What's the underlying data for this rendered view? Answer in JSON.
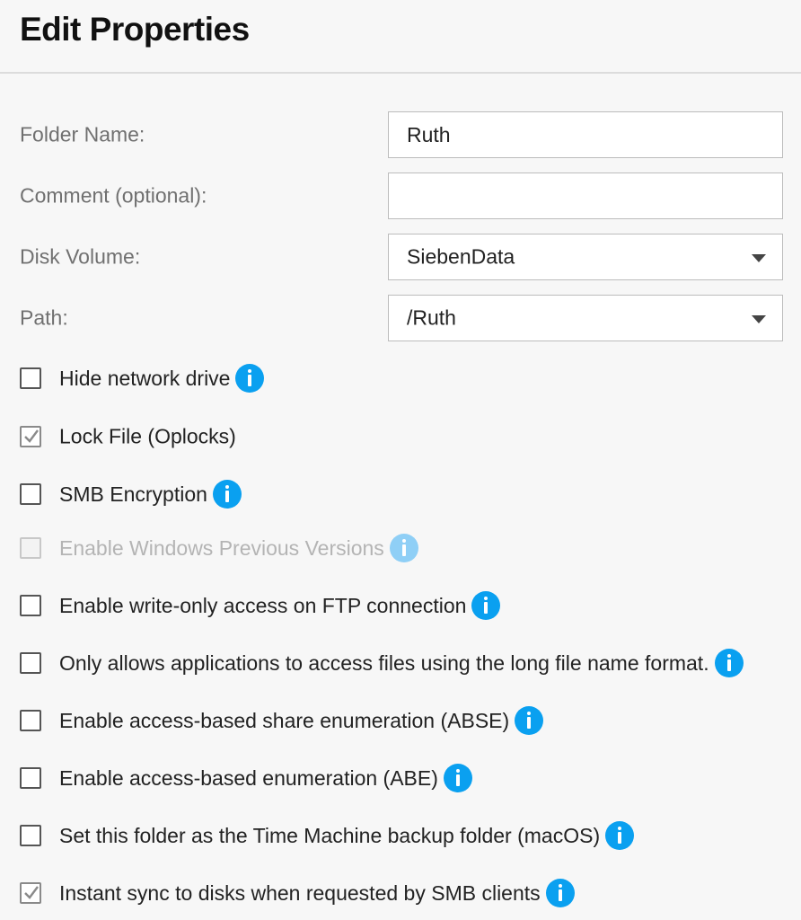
{
  "header": {
    "title": "Edit Properties"
  },
  "form": {
    "folder_name": {
      "label": "Folder Name:",
      "value": "Ruth"
    },
    "comment": {
      "label": "Comment (optional):",
      "value": "",
      "placeholder": ""
    },
    "disk_volume": {
      "label": "Disk Volume:",
      "value": "SiebenData"
    },
    "path": {
      "label": "Path:",
      "value": "/Ruth"
    }
  },
  "options": [
    {
      "label": "Hide network drive",
      "checked": false,
      "disabled": false,
      "info": true
    },
    {
      "label": "Lock File (Oplocks)",
      "checked": true,
      "disabled": false,
      "info": false
    },
    {
      "label": "SMB Encryption",
      "checked": false,
      "disabled": false,
      "info": true
    },
    {
      "label": "Enable Windows Previous Versions",
      "checked": false,
      "disabled": true,
      "info": true
    },
    {
      "label": "Enable write-only access on FTP connection",
      "checked": false,
      "disabled": false,
      "info": true
    },
    {
      "label": "Only allows applications to access files using the long file name format.",
      "checked": false,
      "disabled": false,
      "info": true
    },
    {
      "label": "Enable access-based share enumeration (ABSE)",
      "checked": false,
      "disabled": false,
      "info": true
    },
    {
      "label": "Enable access-based enumeration (ABE)",
      "checked": false,
      "disabled": false,
      "info": true
    },
    {
      "label": "Set this folder as the Time Machine backup folder (macOS)",
      "checked": false,
      "disabled": false,
      "info": true
    },
    {
      "label": "Instant sync to disks when requested by SMB clients",
      "checked": true,
      "disabled": false,
      "info": true
    }
  ],
  "colors": {
    "accent": "#0aa0f0",
    "accent_disabled": "#8fcff6",
    "label_gray": "#707070"
  },
  "icons": {
    "info": "info-icon",
    "dropdown": "chevron-down-icon",
    "check": "check-icon"
  }
}
